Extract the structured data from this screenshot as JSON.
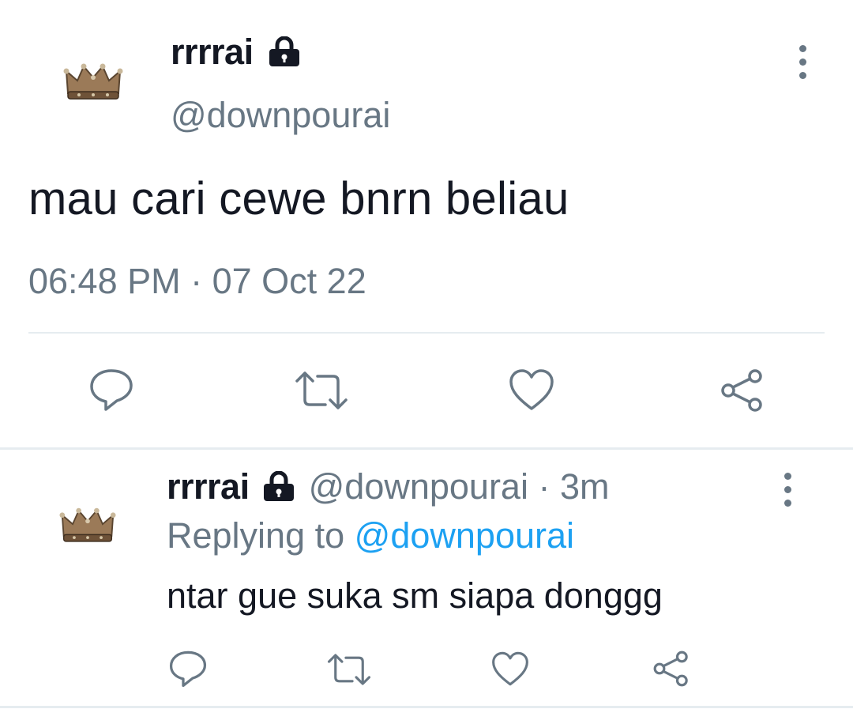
{
  "tweet": {
    "display_name": "rrrrai",
    "handle": "@downpourai",
    "text": "mau cari cewe bnrn beliau",
    "timestamp": "06:48 PM · 07 Oct 22",
    "avatar_icon": "crown-icon",
    "badge_icon": "lock-icon",
    "menu_icon": "more-vertical-icon",
    "actions": [
      "reply-icon",
      "retweet-icon",
      "like-icon",
      "share-icon"
    ]
  },
  "reply": {
    "display_name": "rrrrai",
    "handle": "@downpourai",
    "separator": "·",
    "time_ago": "3m",
    "replying_prefix": "Replying to",
    "replying_to": "@downpourai",
    "text": "ntar gue suka sm siapa donggg",
    "avatar_icon": "crown-icon",
    "badge_icon": "lock-icon",
    "menu_icon": "more-vertical-icon",
    "actions": [
      "reply-icon",
      "retweet-icon",
      "like-icon",
      "share-icon"
    ]
  },
  "colors": {
    "text_primary": "#141823",
    "text_secondary": "#687784",
    "link": "#1da1f2",
    "divider": "#e6ecf0",
    "crown": "#8a6a4a"
  }
}
